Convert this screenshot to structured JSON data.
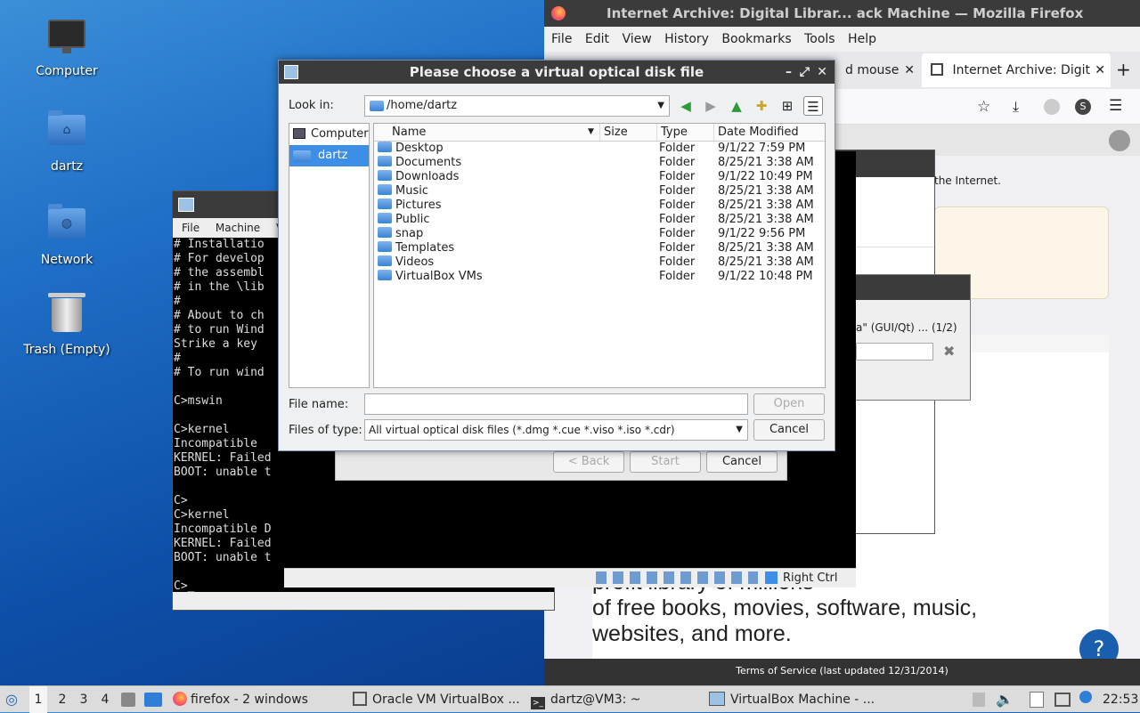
{
  "desktop": {
    "icons": [
      {
        "label": "Computer"
      },
      {
        "label": "dartz"
      },
      {
        "label": "Network"
      },
      {
        "label": "Trash (Empty)"
      }
    ]
  },
  "firefox": {
    "title": "Internet Archive: Digital Librar...  ack Machine — Mozilla Firefox",
    "menu": [
      "File",
      "Edit",
      "View",
      "History",
      "Bookmarks",
      "Tools",
      "Help"
    ],
    "tabs": [
      {
        "label": "d mouse"
      },
      {
        "label": "Internet Archive: Digit"
      }
    ],
    "page": {
      "snippet": "the Internet.",
      "headline": "profit library of millions\nof free books, movies, software, music,\nwebsites, and more.",
      "footer": "Terms of Service (last updated 12/31/2014)"
    }
  },
  "mid_dialog": {
    "text": "a\" (GUI/Qt) ... (1/2)"
  },
  "vm_console": {
    "menu": [
      "File",
      "Machine",
      "V"
    ],
    "lines": [
      "# Installatio",
      "# For develop",
      "# the assembl",
      "# in the \\lib",
      "#",
      "# About to ch",
      "# to run Wind",
      "Strike a key",
      "#",
      "# To run wind",
      "",
      "C>mswin",
      "",
      "C>kernel",
      "Incompatible",
      "KERNEL: Failed",
      "BOOT: unable t",
      "",
      "C>",
      "C>kernel",
      "Incompatible D",
      "KERNEL: Failed",
      "BOOT: unable t",
      "",
      "C>_"
    ],
    "host_key": "Right Ctrl"
  },
  "wizard": {
    "back": "< Back",
    "start": "Start",
    "cancel": "Cancel"
  },
  "dialog": {
    "title": "Please choose a virtual optical disk file",
    "look_in_label": "Look in:",
    "look_in_value": "/home/dartz",
    "sidebar": [
      "Computer",
      "dartz"
    ],
    "columns": [
      "Name",
      "Size",
      "Type",
      "Date Modified"
    ],
    "rows": [
      {
        "name": "Desktop",
        "size": "",
        "type": "Folder",
        "modified": "9/1/22 7:59 PM"
      },
      {
        "name": "Documents",
        "size": "",
        "type": "Folder",
        "modified": "8/25/21 3:38 AM"
      },
      {
        "name": "Downloads",
        "size": "",
        "type": "Folder",
        "modified": "9/1/22 10:49 PM"
      },
      {
        "name": "Music",
        "size": "",
        "type": "Folder",
        "modified": "8/25/21 3:38 AM"
      },
      {
        "name": "Pictures",
        "size": "",
        "type": "Folder",
        "modified": "8/25/21 3:38 AM"
      },
      {
        "name": "Public",
        "size": "",
        "type": "Folder",
        "modified": "8/25/21 3:38 AM"
      },
      {
        "name": "snap",
        "size": "",
        "type": "Folder",
        "modified": "9/1/22 9:56 PM"
      },
      {
        "name": "Templates",
        "size": "",
        "type": "Folder",
        "modified": "8/25/21 3:38 AM"
      },
      {
        "name": "Videos",
        "size": "",
        "type": "Folder",
        "modified": "8/25/21 3:38 AM"
      },
      {
        "name": "VirtualBox VMs",
        "size": "",
        "type": "Folder",
        "modified": "9/1/22 10:48 PM"
      }
    ],
    "file_name_label": "File name:",
    "file_name_value": "",
    "open_label": "Open",
    "files_of_type_label": "Files of type:",
    "files_of_type_value": "All virtual optical disk files (*.dmg *.cue *.viso *.iso *.cdr)",
    "cancel_label": "Cancel"
  },
  "taskbar": {
    "workspaces": [
      "1",
      "2",
      "3",
      "4"
    ],
    "tasks": [
      {
        "label": "firefox - 2 windows"
      },
      {
        "label": "Oracle VM VirtualBox ..."
      },
      {
        "label": "dartz@VM3: ~"
      },
      {
        "label": "VirtualBox Machine - ..."
      }
    ],
    "clock": "22:53"
  }
}
